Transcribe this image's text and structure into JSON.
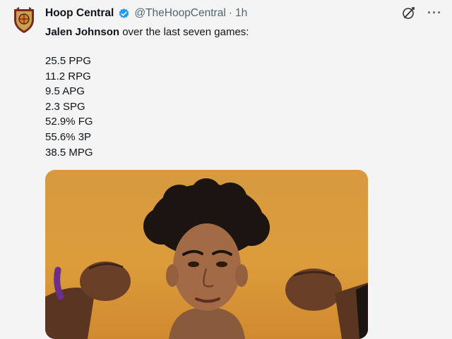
{
  "account": {
    "name": "Hoop Central",
    "handle": "@TheHoopCentral",
    "separator": "·",
    "time": "1h"
  },
  "tweet": {
    "subject": "Jalen Johnson",
    "intro_rest": " over the last seven games:",
    "stats": [
      "25.5 PPG",
      "11.2 RPG",
      "9.5 APG",
      "2.3 SPG",
      "52.9% FG",
      "55.6% 3P",
      "38.5 MPG"
    ]
  },
  "ui": {
    "more_label": "···",
    "colors": {
      "verified": "#1d9bf0",
      "media_bg": "#d99a3c",
      "muted": "#536471"
    }
  },
  "icons": {
    "avatar": "hoop-central-logo",
    "verified": "verified-badge-icon",
    "x": "x-logo-icon",
    "more": "more-options-icon"
  }
}
